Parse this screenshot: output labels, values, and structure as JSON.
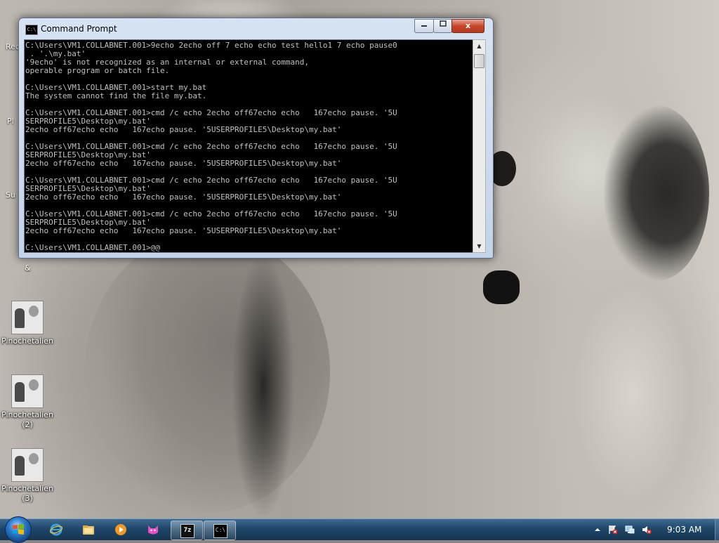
{
  "window": {
    "title": "Command Prompt",
    "title_icon": "C:\\",
    "minimize_icon": "minimize-icon",
    "maximize_icon": "maximize-icon",
    "close_label": "x"
  },
  "console": {
    "lines": [
      "C:\\Users\\VM1.COLLABNET.001>9echo 2echo off 7 echo echo test hello1 7 echo pause0",
      " . '.\\my.bat'",
      "'9echo' is not recognized as an internal or external command,",
      "operable program or batch file.",
      "",
      "C:\\Users\\VM1.COLLABNET.001>start my.bat",
      "The system cannot find the file my.bat.",
      "",
      "C:\\Users\\VM1.COLLABNET.001>cmd /c echo 2echo off67echo echo   167echo pause. '5U",
      "SERPROFILE5\\Desktop\\my.bat'",
      "2echo off67echo echo   167echo pause. '5USERPROFILE5\\Desktop\\my.bat'",
      "",
      "C:\\Users\\VM1.COLLABNET.001>cmd /c echo 2echo off67echo echo   167echo pause. '5U",
      "SERPROFILE5\\Desktop\\my.bat'",
      "2echo off67echo echo   167echo pause. '5USERPROFILE5\\Desktop\\my.bat'",
      "",
      "C:\\Users\\VM1.COLLABNET.001>cmd /c echo 2echo off67echo echo   167echo pause. '5U",
      "SERPROFILE5\\Desktop\\my.bat'",
      "2echo off67echo echo   167echo pause. '5USERPROFILE5\\Desktop\\my.bat'",
      "",
      "C:\\Users\\VM1.COLLABNET.001>cmd /c echo 2echo off67echo echo   167echo pause. '5U",
      "SERPROFILE5\\Desktop\\my.bat'",
      "2echo off67echo echo   167echo pause. '5USERPROFILE5\\Desktop\\my.bat'",
      "",
      "C:\\Users\\VM1.COLLABNET.001>@@"
    ]
  },
  "desktop": {
    "partial_labels": [
      "Rec",
      "Pl",
      "Su",
      "&"
    ],
    "icons": [
      {
        "label_line1": "Pinochetalien",
        "label_line2": ""
      },
      {
        "label_line1": "Pinochetalien",
        "label_line2": "(2)"
      },
      {
        "label_line1": "Pinochetalien",
        "label_line2": "(3)"
      }
    ]
  },
  "taskbar": {
    "start_icon": "windows-start-icon",
    "pinned": [
      {
        "name": "internet-explorer-icon"
      },
      {
        "name": "file-explorer-icon"
      },
      {
        "name": "media-player-icon"
      },
      {
        "name": "cat-app-icon"
      },
      {
        "name": "7zip-icon",
        "text": "7z"
      },
      {
        "name": "command-prompt-icon",
        "text": "C:\\"
      }
    ],
    "tray": {
      "clock": "9:03 AM"
    }
  },
  "colors": {
    "console_bg": "#000000",
    "console_text": "#c0c0c0",
    "titlebar": "#d6e3f2",
    "taskbar": "#1f4669",
    "close_button": "#c7462b"
  }
}
